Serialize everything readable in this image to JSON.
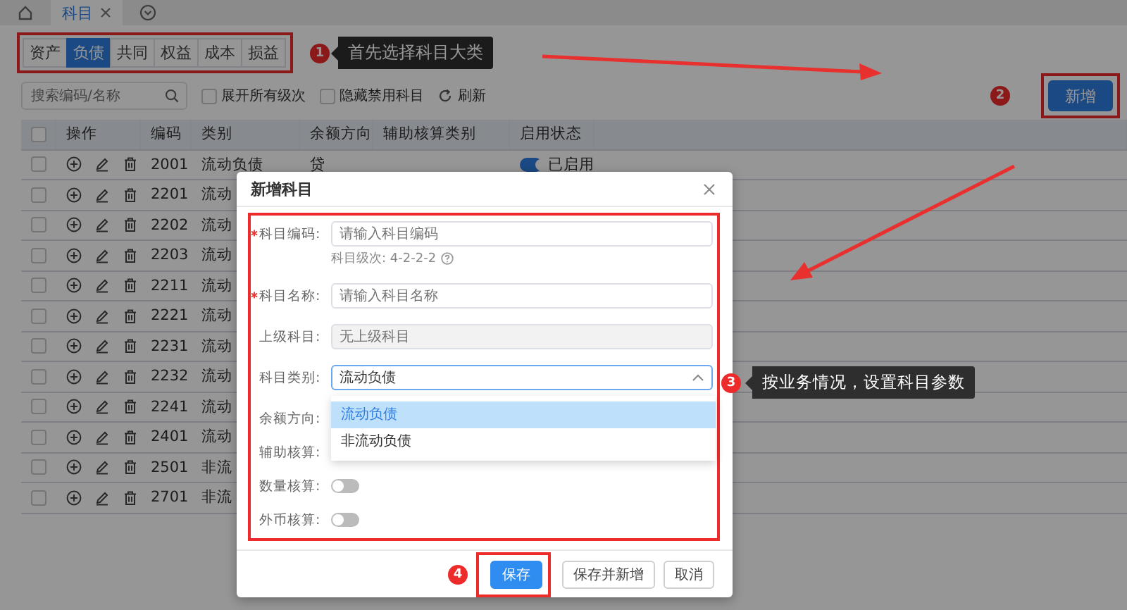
{
  "top_tabs": [
    {
      "label": "科目",
      "selected": true
    }
  ],
  "categories": [
    {
      "label": "资产",
      "selected": false
    },
    {
      "label": "负债",
      "selected": true
    },
    {
      "label": "共同",
      "selected": false
    },
    {
      "label": "权益",
      "selected": false
    },
    {
      "label": "成本",
      "selected": false
    },
    {
      "label": "损益",
      "selected": false
    }
  ],
  "search": {
    "placeholder": "搜索编码/名称"
  },
  "options": [
    {
      "label": "展开所有级次",
      "checked": false
    },
    {
      "label": "隐藏禁用科目",
      "checked": false
    }
  ],
  "refresh": "刷新",
  "add_button": "新增",
  "table": {
    "header_checked": false,
    "columns": [
      "操作",
      "编码",
      "类别",
      "余额方向",
      "辅助核算类别",
      "启用状态"
    ],
    "rows": [
      {
        "checked": false,
        "code": "2001",
        "category": "流动负债",
        "direction": "贷",
        "status": {
          "on": true,
          "label": "已启用"
        }
      },
      {
        "checked": false,
        "code": "2201",
        "category": "流动"
      },
      {
        "checked": false,
        "code": "2202",
        "category": "流动"
      },
      {
        "checked": false,
        "code": "2203",
        "category": "流动"
      },
      {
        "checked": false,
        "code": "2211",
        "category": "流动"
      },
      {
        "checked": false,
        "code": "2221",
        "category": "流动"
      },
      {
        "checked": false,
        "code": "2231",
        "category": "流动"
      },
      {
        "checked": false,
        "code": "2232",
        "category": "流动"
      },
      {
        "checked": false,
        "code": "2241",
        "category": "流动"
      },
      {
        "checked": false,
        "code": "2401",
        "category": "流动"
      },
      {
        "checked": false,
        "code": "2501",
        "category": "非流"
      },
      {
        "checked": false,
        "code": "2701",
        "category": "非流"
      }
    ]
  },
  "dialog": {
    "title": "新增科目",
    "fields": [
      {
        "label": "科目编码:",
        "required": true,
        "kind": "text",
        "disabled": false,
        "placeholder": "请输入科目编码",
        "hint": "科目级次: 4-2-2-2"
      },
      {
        "label": "科目名称:",
        "required": true,
        "kind": "text",
        "disabled": false,
        "placeholder": "请输入科目名称"
      },
      {
        "label": "上级科目:",
        "required": false,
        "kind": "text",
        "disabled": true,
        "placeholder": "无上级科目"
      },
      {
        "label": "科目类别:",
        "required": false,
        "kind": "select",
        "value": "流动负债",
        "expanded": true,
        "options": [
          {
            "label": "流动负债",
            "selected": true
          },
          {
            "label": "非流动负债",
            "selected": false
          }
        ]
      },
      {
        "label": "余额方向:",
        "required": false,
        "kind": "covered"
      },
      {
        "label": "辅助核算:",
        "required": false,
        "kind": "covered"
      },
      {
        "label": "数量核算:",
        "required": false,
        "kind": "switch",
        "on": false
      },
      {
        "label": "外币核算:",
        "required": false,
        "kind": "switch",
        "on": false
      }
    ],
    "buttons": [
      {
        "label": "保存",
        "kind": "primary",
        "highlighted": true
      },
      {
        "label": "保存并新增",
        "kind": "default",
        "highlighted": false
      },
      {
        "label": "取消",
        "kind": "default",
        "highlighted": false
      }
    ]
  },
  "annotations": [
    {
      "number": "1",
      "text": "首先选择科目大类"
    },
    {
      "number": "2"
    },
    {
      "number": "3",
      "text": "按业务情况，设置科目参数"
    },
    {
      "number": "4"
    }
  ]
}
